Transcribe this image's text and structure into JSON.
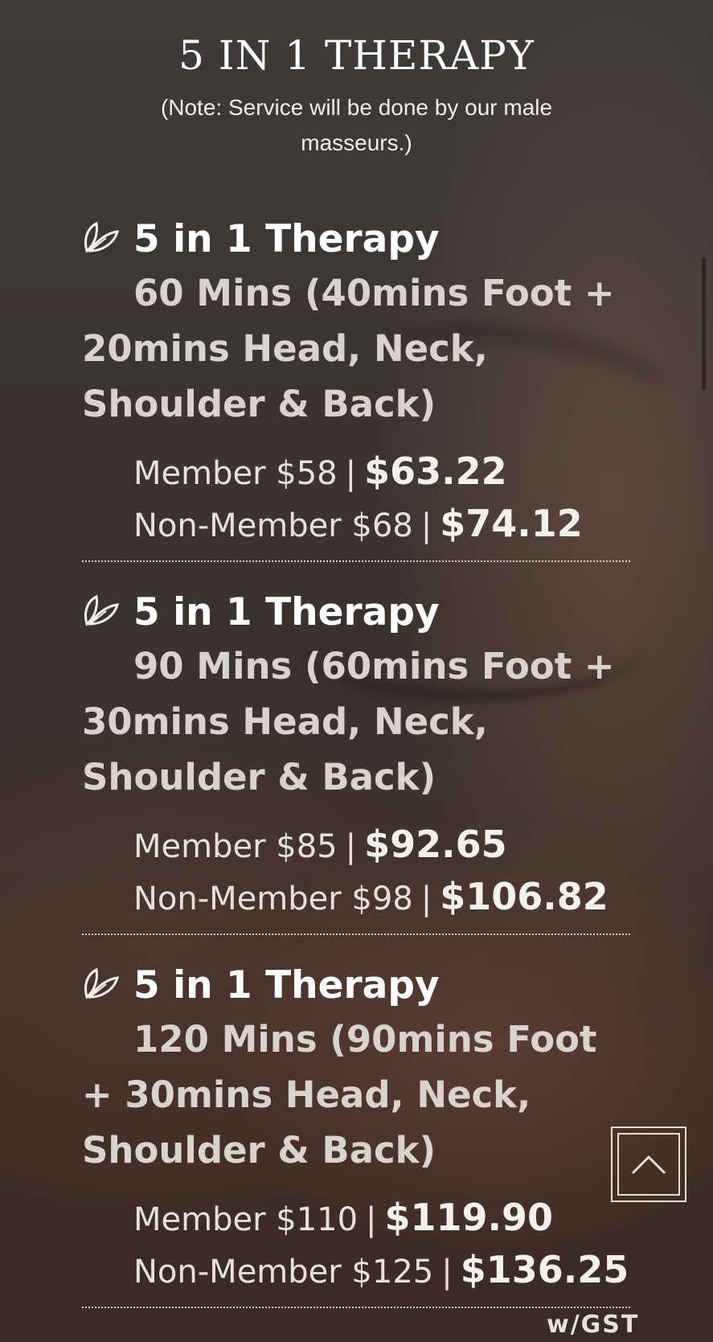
{
  "page": {
    "title": "5 IN 1 THERAPY",
    "note": "(Note: Service will be done by our male masseurs.)"
  },
  "services": [
    {
      "icon": "leaf-icon",
      "name": "5 in 1 Therapy",
      "duration": "60 Mins (40mins Foot + 20mins Head, Neck, Shoulder & Back)",
      "member_label": "Member $58",
      "member_gst": "$63.22",
      "nonmember_label": "Non-Member $68",
      "nonmember_gst": "$74.12"
    },
    {
      "icon": "leaf-icon",
      "name": "5 in 1 Therapy",
      "duration": "90 Mins (60mins Foot + 30mins Head, Neck, Shoulder & Back)",
      "member_label": "Member $85",
      "member_gst": "$92.65",
      "nonmember_label": "Non-Member $98",
      "nonmember_gst": "$106.82"
    },
    {
      "icon": "leaf-icon",
      "name": "5 in 1 Therapy",
      "duration": "120 Mins (90mins Foot + 30mins Head, Neck, Shoulder & Back)",
      "member_label": "Member $110",
      "member_gst": "$119.90",
      "nonmember_label": "Non-Member $125",
      "nonmember_gst": "$136.25"
    }
  ],
  "separator": "|",
  "footer": {
    "gst_note": "w/GST"
  },
  "controls": {
    "scroll_top_icon": "chevron-up-icon"
  },
  "colors": {
    "text": "#ffffff",
    "accent_border": "#e9dfd0"
  }
}
